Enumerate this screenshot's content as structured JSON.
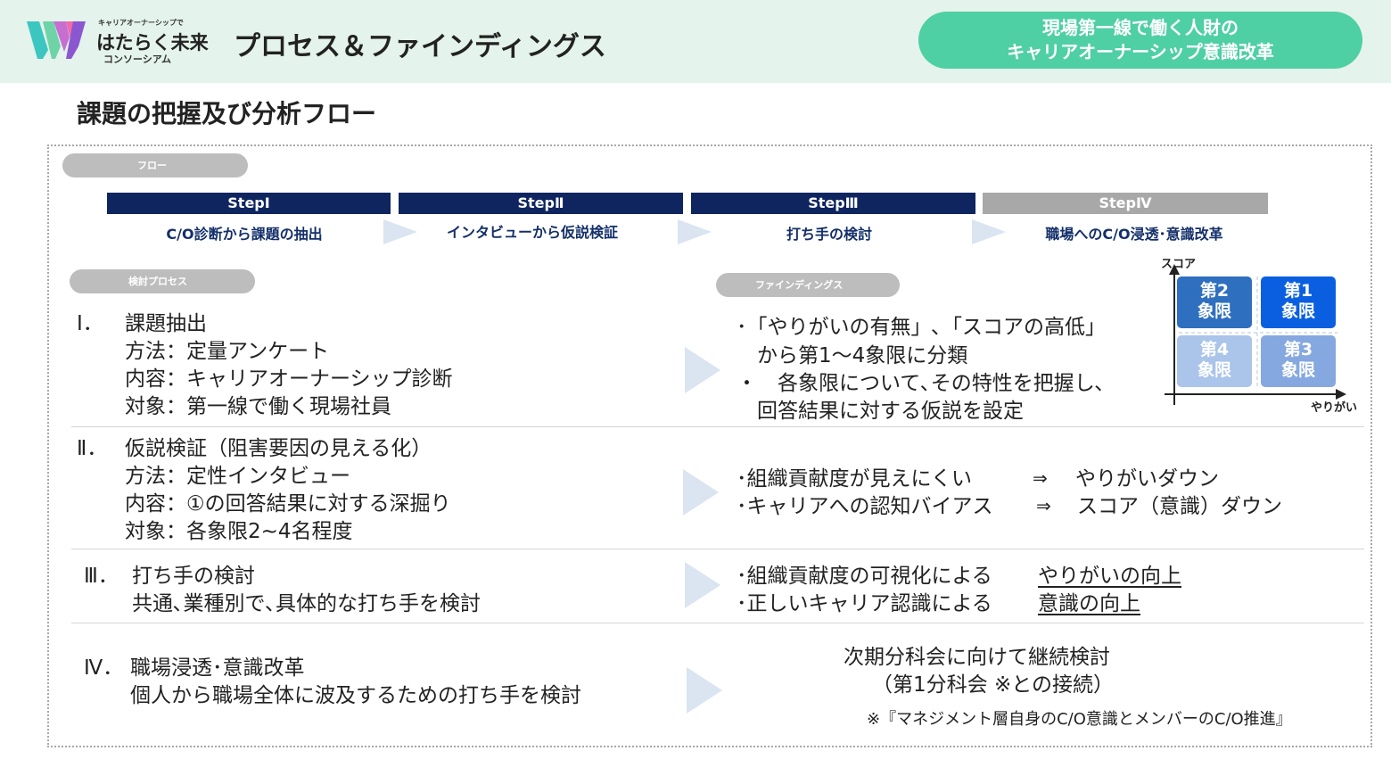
{
  "header": {
    "logo_small": "キャリアオーナーシップで",
    "logo_main": "はたらく未来",
    "logo_sub": "コンソーシアム",
    "title": "プロセス＆ファインディングス",
    "badge_line1": "現場第一線で働く人財の",
    "badge_line2": "キャリアオーナーシップ意識改革",
    "colors": {
      "header_bg": "#e4f3ec",
      "badge_bg": "#4fcfa4"
    }
  },
  "section_title": "課題の把握及び分析フロー",
  "flow_pill": "フロー",
  "steps": [
    {
      "label": "StepⅠ",
      "desc": "C/O診断から課題の抽出"
    },
    {
      "label": "StepⅡ",
      "desc": "インタビューから仮説検証"
    },
    {
      "label": "StepⅢ",
      "desc": "打ち手の検討"
    },
    {
      "label": "StepⅣ",
      "desc": "職場へのC/O浸透･意識改革"
    }
  ],
  "process_pill": "検討プロセス",
  "findings_pill": "ファインディングス",
  "rows": [
    {
      "num": "Ⅰ．",
      "lines": [
        "課題抽出",
        "方法：定量アンケート",
        "内容：キャリアオーナーシップ診断",
        "対象：第一線で働く現場社員"
      ],
      "findings": [
        "･「やりがいの有無」､「スコアの高低」",
        "　から第1～4象限に分類",
        "・　各象限について､その特性を把握し､",
        "　回答結果に対する仮説を設定"
      ]
    },
    {
      "num": "Ⅱ．",
      "lines": [
        "仮説検証（阻害要因の見える化）",
        "方法：定性インタビュー",
        "内容：①の回答結果に対する深掘り",
        "対象：各象限2~4名程度"
      ],
      "findings_left": [
        "･組織貢献度が見えにくい",
        "･キャリアへの認知バイアス"
      ],
      "findings_arrow": "⇒",
      "findings_right": [
        "やりがいダウン",
        "スコア（意識）ダウン"
      ]
    },
    {
      "num": "Ⅲ．",
      "lines": [
        "打ち手の検討",
        "共通､業種別で､具体的な打ち手を検討"
      ],
      "findings_left": [
        "･組織貢献度の可視化による",
        "･正しいキャリア認識による"
      ],
      "findings_right": [
        "やりがいの向上",
        "意識の向上"
      ]
    },
    {
      "num": "Ⅳ．",
      "lines": [
        "職場浸透･意識改革",
        "個人から職場全体に波及するための打ち手を検討"
      ],
      "findings": [
        "次期分科会に向けて継続検討",
        "（第1分科会 ※との接続）"
      ],
      "note": "※『マネジメント層自身のC/O意識とメンバーのC/O推進』"
    }
  ],
  "quadrant": {
    "y_label": "スコア",
    "x_label": "やりがい",
    "cells": [
      {
        "label1": "第2",
        "label2": "象限",
        "color": "#2e6fbf"
      },
      {
        "label1": "第1",
        "label2": "象限",
        "color": "#0a5fe0"
      },
      {
        "label1": "第4",
        "label2": "象限",
        "color": "#aac4ea"
      },
      {
        "label1": "第3",
        "label2": "象限",
        "color": "#86a8e0"
      }
    ]
  }
}
